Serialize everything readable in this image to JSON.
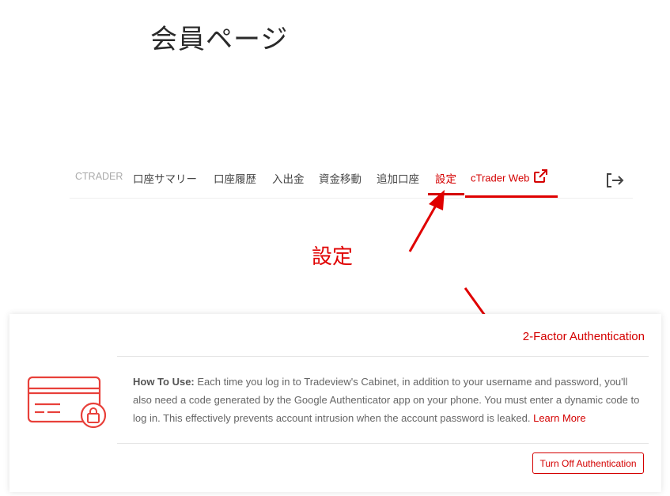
{
  "page_title": "会員ページ",
  "nav": {
    "items": [
      {
        "label": "CTRADER"
      },
      {
        "label": "口座サマリー"
      },
      {
        "label": "口座履歴"
      },
      {
        "label": "入出金"
      },
      {
        "label": "資金移動"
      },
      {
        "label": "追加口座"
      },
      {
        "label": "設定"
      },
      {
        "label": "cTrader Web"
      }
    ],
    "logout_icon": "logout-icon",
    "external_icon": "external-link-icon",
    "accent_color": "#d40000"
  },
  "annotation": {
    "label": "設定",
    "color": "#e00000"
  },
  "card": {
    "title": "2-Factor Authentication",
    "how_to_label": "How To Use:",
    "description": " Each time you log in to Tradeview's Cabinet, in addition to your username and password, you'll also need a code generated by the Google Authenticator app on your phone. You must enter a dynamic code to log in. This effectively prevents account intrusion when the account password is leaked. ",
    "learn_more": "Learn More",
    "button_label": "Turn Off Authentication",
    "icon": "credit-card-lock-icon"
  }
}
